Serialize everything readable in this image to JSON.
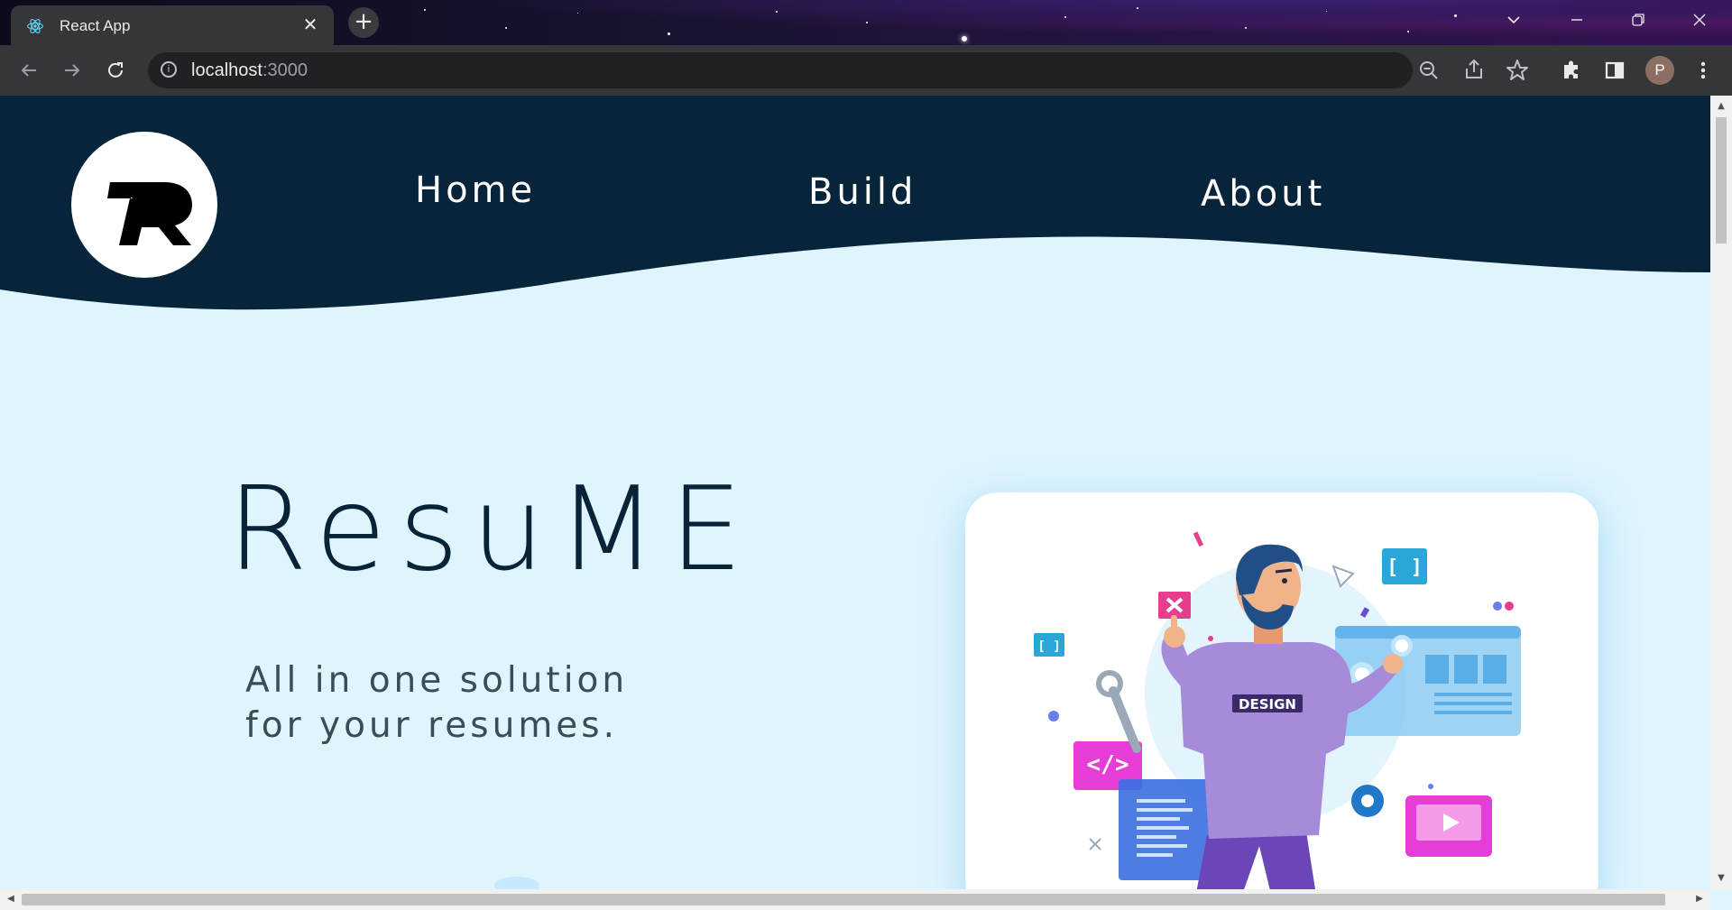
{
  "browser": {
    "tab_title": "React App",
    "address_host": "localhost",
    "address_port": ":3000",
    "profile_initial": "P",
    "close_tab_glyph": "✕",
    "new_tab_glyph": "+"
  },
  "nav": {
    "items": [
      {
        "label": "Home"
      },
      {
        "label": "Build"
      },
      {
        "label": "About"
      }
    ]
  },
  "hero": {
    "title": "ResuME",
    "tagline_line1": "All in one solution",
    "tagline_line2": "for your resumes."
  },
  "illustration": {
    "shirt_text": "DESIGN",
    "code_tag": "</>",
    "bracket_tag": "[ ]"
  },
  "colors": {
    "header_bg": "#06243a",
    "page_bg": "#dff4fd",
    "hero_title": "#062338",
    "tagline": "#3b4b58",
    "accent_pink": "#e63dd6",
    "accent_blue": "#3aa7e0",
    "shirt_purple": "#a78bdb"
  },
  "icons": [
    "react-favicon",
    "back-arrow",
    "forward-arrow",
    "reload-icon",
    "info-icon",
    "zoom-out-icon",
    "share-icon",
    "star-icon",
    "extensions-icon",
    "sidebar-icon",
    "kebab-menu-icon",
    "minimize-icon",
    "restore-icon",
    "close-icon",
    "tab-search-icon"
  ]
}
